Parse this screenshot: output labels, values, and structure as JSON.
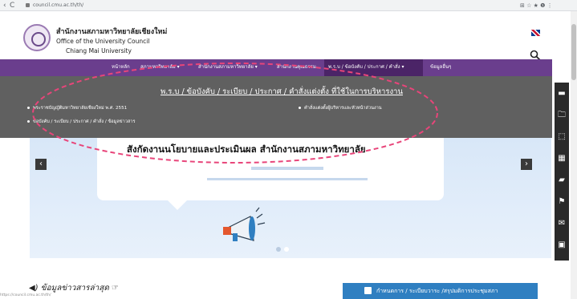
{
  "browser": {
    "url": "council.cmu.ac.th/th/",
    "back": "‹",
    "forward": "›",
    "reload": "C",
    "toolbar_icons": "⊞ ☆ ★ ❶ ⋮"
  },
  "header": {
    "org_thai": "สำนักงานสภามหาวิทยาลัยเชียงใหม่",
    "org_english": "Office of the University Council",
    "org_city": "Chiang Mai University"
  },
  "nav": {
    "items": [
      "หน้าหลัก",
      "สภามหาวิทยาลัย ▾",
      "สำนักงานสภามหาวิทยาลัย ▾",
      "สำนักงานคุณธรรม",
      "พ.ร.บ / ข้อบังคับ / ประกาศ / คำสั่ง ▾",
      "ข้อมูลอื่นๆ"
    ]
  },
  "dropdown": {
    "title": "พ.ร.บ / ข้อบังคับ / ระเบียบ / ประกาศ / คำสั่งแต่งตั้ง ที่ใช้ในการบริหารงาน",
    "links": [
      "พระราชบัญญัติมหาวิทยาลัยเชียงใหม่ พ.ศ. 2551",
      "ข้อบังคับ / ระเบียบ / ประกาศ / คำสั่ง / ข้อมูลข่าวสาร",
      "คำสั่งแต่งตั้งผู้บริหารและหัวหน้าส่วนงาน"
    ]
  },
  "hero": {
    "heading": "สังกัดงานนโยบายและประเมินผล สำนักงานสภามหาวิทยาลัย",
    "prev": "‹",
    "next": "›"
  },
  "sidebar": {
    "icons": [
      "▬",
      "🗀",
      "⬚",
      "▦",
      "▰",
      "⚑",
      "✉",
      "▣"
    ]
  },
  "bottom": {
    "news_heading": "◀) ข้อมูลข่าวสารล่าสุด ☞",
    "schedule_button": "กำหนดการ / ระเบียบวาระ /สรุปมติการประชุมสภา",
    "status_url": "https://council.cmu.ac.th/th/"
  },
  "colors": {
    "nav_purple": "#6a3e8d",
    "nav_active": "#4b2467",
    "dropdown_gray": "#606060",
    "annotation_pink": "#e8457a",
    "button_blue": "#2f7fc1"
  }
}
